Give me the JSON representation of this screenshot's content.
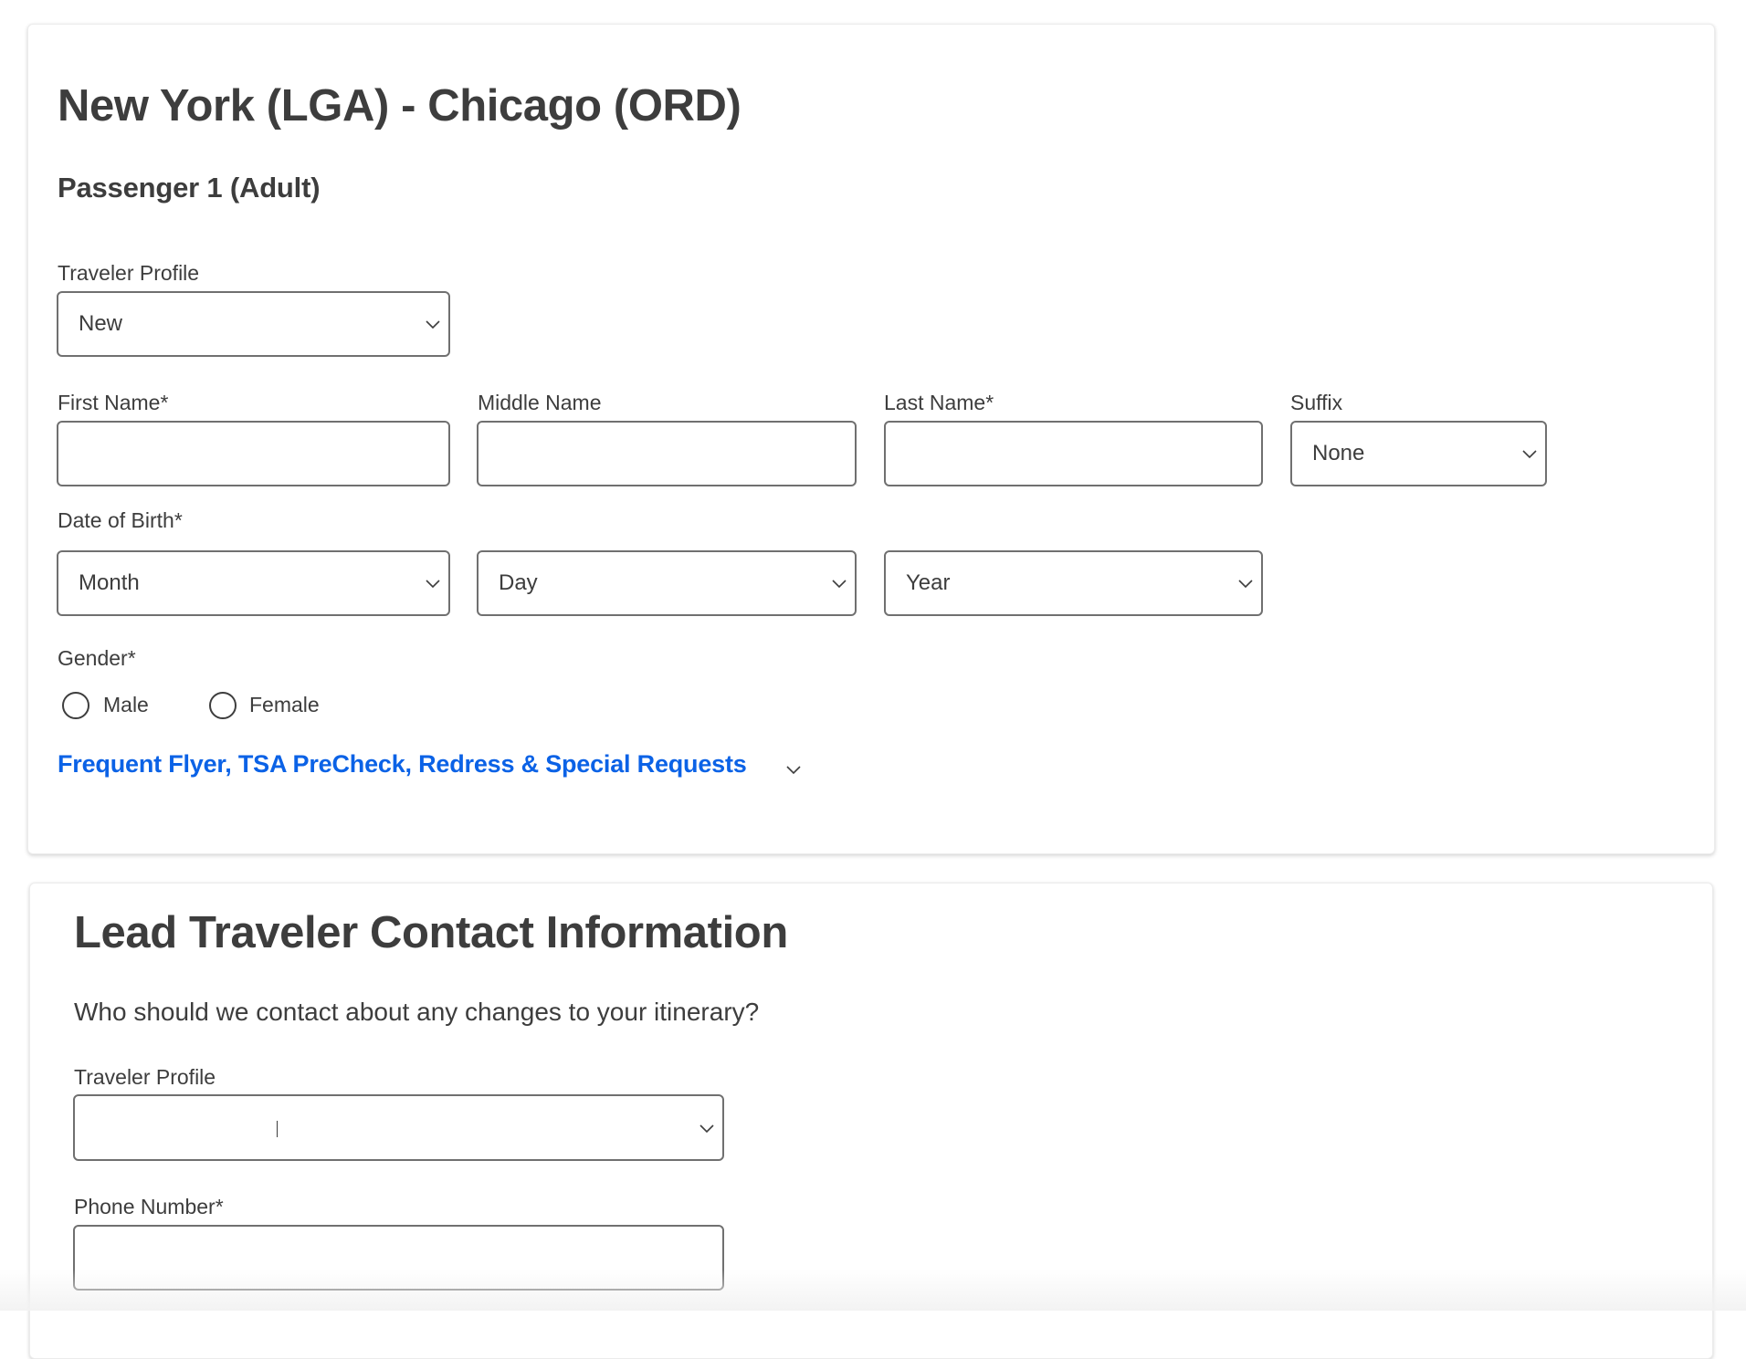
{
  "passenger_section": {
    "route_title": "New York (LGA) - Chicago (ORD)",
    "passenger_heading": "Passenger 1 (Adult)",
    "traveler_profile": {
      "label": "Traveler Profile",
      "value": "New"
    },
    "first_name": {
      "label": "First Name*",
      "value": ""
    },
    "middle_name": {
      "label": "Middle Name",
      "value": ""
    },
    "last_name": {
      "label": "Last Name*",
      "value": ""
    },
    "suffix": {
      "label": "Suffix",
      "value": "None"
    },
    "date_of_birth": {
      "label": "Date of Birth*",
      "month": "Month",
      "day": "Day",
      "year": "Year"
    },
    "gender": {
      "label": "Gender*",
      "options": [
        {
          "label": "Male",
          "selected": false
        },
        {
          "label": "Female",
          "selected": false
        }
      ]
    },
    "extras_link": "Frequent Flyer, TSA PreCheck, Redress & Special Requests"
  },
  "contact_section": {
    "title": "Lead Traveler Contact Information",
    "subtitle": "Who should we contact about any changes to your itinerary?",
    "traveler_profile": {
      "label": "Traveler Profile",
      "value": ""
    },
    "phone_number": {
      "label": "Phone Number*",
      "value": ""
    }
  },
  "colors": {
    "text": "#3d3d3d",
    "link": "#0b62e6",
    "field_border": "#707070"
  }
}
